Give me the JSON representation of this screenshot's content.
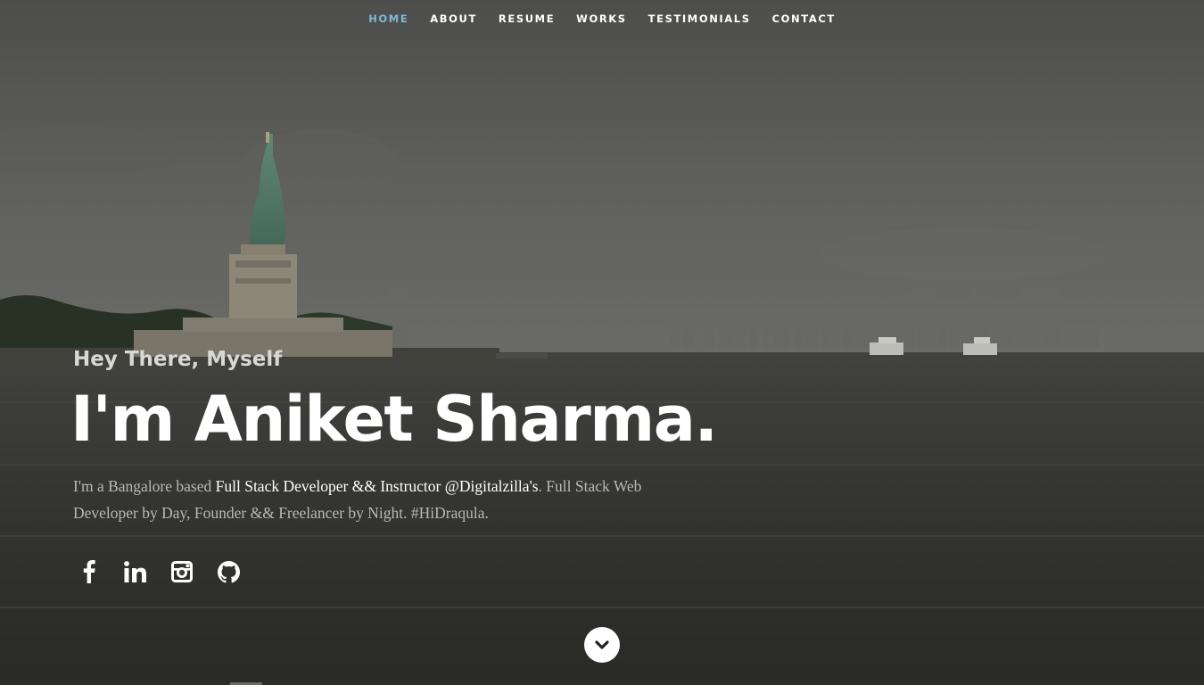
{
  "nav": {
    "items": [
      {
        "label": "HOME",
        "active": true
      },
      {
        "label": "ABOUT",
        "active": false
      },
      {
        "label": "RESUME",
        "active": false
      },
      {
        "label": "WORKS",
        "active": false
      },
      {
        "label": "TESTIMONIALS",
        "active": false
      },
      {
        "label": "CONTACT",
        "active": false
      }
    ],
    "active_color": "#7fb8d8"
  },
  "hero": {
    "greeting": "Hey There, Myself",
    "name": "I'm Aniket Sharma.",
    "bio": {
      "prefix": "I'm a Bangalore based ",
      "highlight": "Full Stack Developer && Instructor @Digitalzilla's",
      "suffix": ". Full Stack Web Developer by Day, Founder && Freelancer by Night. #HiDraqula."
    }
  },
  "social": [
    {
      "icon": "facebook-icon"
    },
    {
      "icon": "linkedin-icon"
    },
    {
      "icon": "instagram-icon"
    },
    {
      "icon": "github-icon"
    }
  ],
  "scroll_down": {
    "icon": "chevron-down-icon"
  }
}
